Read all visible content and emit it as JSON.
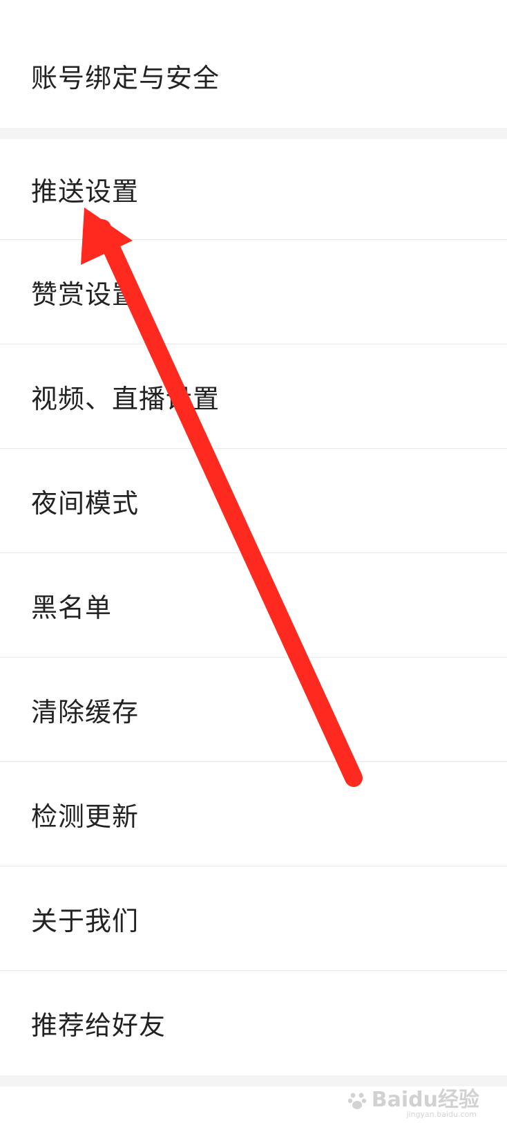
{
  "settings": {
    "group1": {
      "items": [
        {
          "label": "账号绑定与安全"
        }
      ]
    },
    "group2": {
      "items": [
        {
          "label": "推送设置"
        },
        {
          "label": "赞赏设置"
        },
        {
          "label": "视频、直播设置"
        },
        {
          "label": "夜间模式"
        },
        {
          "label": "黑名单"
        },
        {
          "label": "清除缓存"
        },
        {
          "label": "检测更新"
        },
        {
          "label": "关于我们"
        },
        {
          "label": "推荐给好友"
        }
      ]
    }
  },
  "annotation": {
    "color": "#ff2a1f",
    "icon": "arrow-icon"
  },
  "watermark": {
    "text": "Baidu经验",
    "subtext": "jingyan.baidu.com"
  },
  "colors": {
    "background": "#ffffff",
    "divider": "#e8e8e8",
    "section_gap": "#f4f4f4",
    "text": "#222222"
  }
}
